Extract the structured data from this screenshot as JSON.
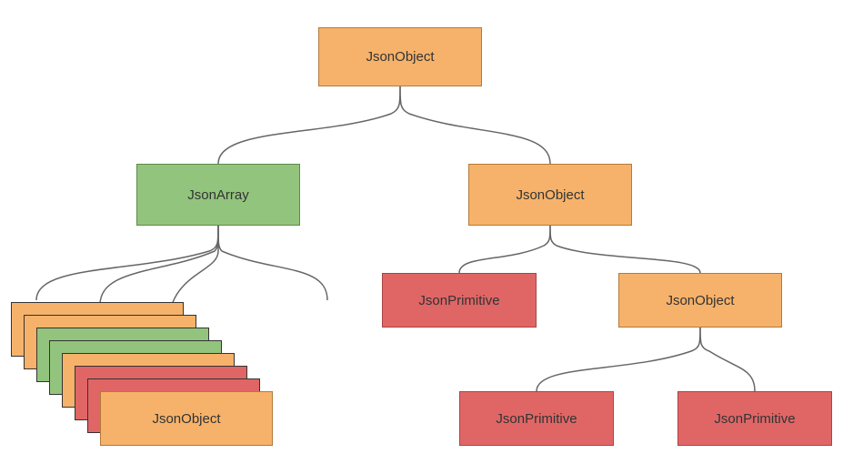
{
  "colors": {
    "orange": "#f6b26b",
    "green": "#92c47d",
    "red": "#e06666"
  },
  "root": {
    "label": "JsonObject"
  },
  "left": {
    "array": {
      "label": "JsonArray"
    },
    "front": {
      "label": "JsonObject"
    },
    "stack_colors": [
      "orange",
      "orange",
      "green",
      "green",
      "orange",
      "red",
      "red"
    ]
  },
  "right": {
    "obj": {
      "label": "JsonObject"
    },
    "prim": {
      "label": "JsonPrimitive"
    },
    "obj2": {
      "label": "JsonObject"
    },
    "prim2a": {
      "label": "JsonPrimitive"
    },
    "prim2b": {
      "label": "JsonPrimitive"
    }
  }
}
